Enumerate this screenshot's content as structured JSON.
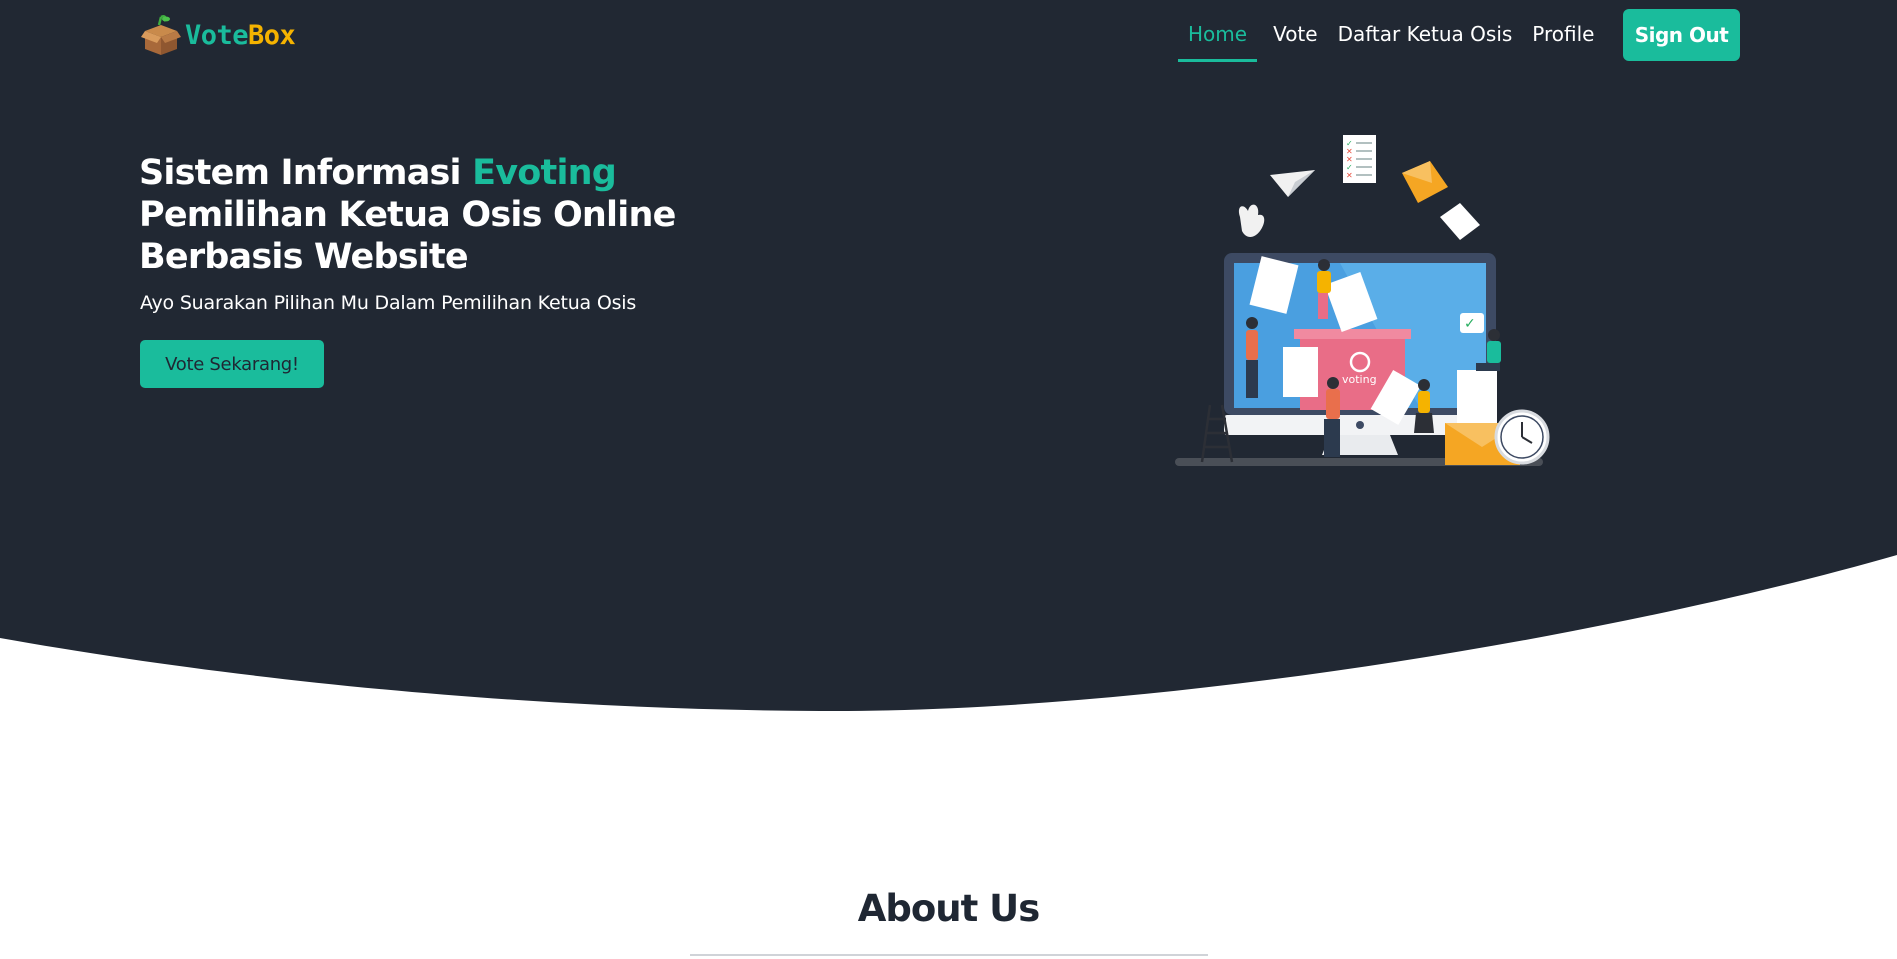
{
  "brand": {
    "part1": "Vote",
    "part2": "Box"
  },
  "nav": {
    "items": [
      "Home",
      "Vote",
      "Daftar Ketua Osis",
      "Profile"
    ],
    "active": "Home",
    "signout_label": "Sign Out"
  },
  "hero": {
    "title_prefix": "Sistem Informasi ",
    "title_accent": "Evoting",
    "title_line2": "Pemilihan Ketua Osis Online",
    "title_line3": "Berbasis Website",
    "subtitle": "Ayo Suarakan Pilihan Mu Dalam Pemilihan Ketua Osis",
    "cta_label": "Vote Sekarang!",
    "illustration_label": "voting"
  },
  "about": {
    "title": "About Us"
  },
  "colors": {
    "background": "#212833",
    "accent": "#1abc9c",
    "brand_yellow": "#f5b300"
  }
}
